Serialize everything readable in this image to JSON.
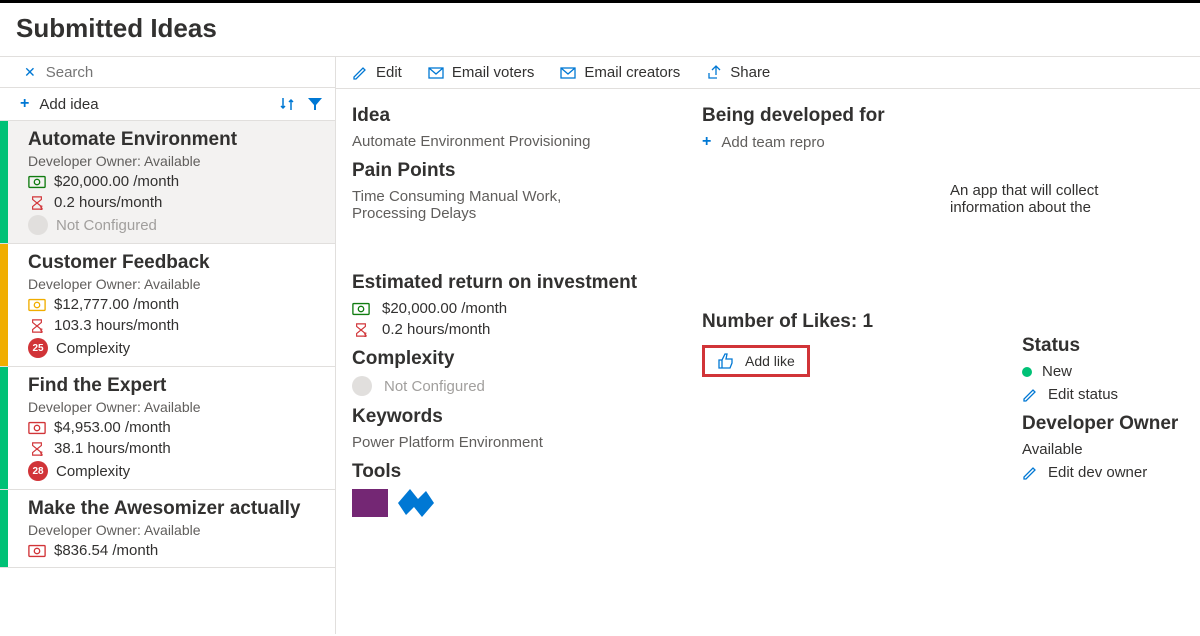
{
  "page_title": "Submitted Ideas",
  "search": {
    "placeholder": "Search"
  },
  "add_idea_label": "Add idea",
  "toolbar": {
    "edit": "Edit",
    "email_voters": "Email voters",
    "email_creators": "Email creators",
    "share": "Share"
  },
  "ideas": [
    {
      "title": "Automate Environment",
      "owner": "Developer Owner: Available",
      "money": "$20,000.00 /month",
      "hours": "0.2 hours/month",
      "complexity": "Not Configured",
      "bar": "green",
      "money_color": "green",
      "hour_color": "red",
      "badge": ""
    },
    {
      "title": "Customer Feedback",
      "owner": "Developer Owner: Available",
      "money": "$12,777.00 /month",
      "hours": "103.3 hours/month",
      "complexity": "Complexity",
      "bar": "yellow",
      "money_color": "yellow",
      "hour_color": "red",
      "badge": "25"
    },
    {
      "title": "Find the Expert",
      "owner": "Developer Owner: Available",
      "money": "$4,953.00 /month",
      "hours": "38.1 hours/month",
      "complexity": "Complexity",
      "bar": "green",
      "money_color": "red",
      "hour_color": "red",
      "badge": "28"
    },
    {
      "title": "Make the Awesomizer actually",
      "owner": "Developer Owner: Available",
      "money": "$836.54 /month",
      "hours": "",
      "complexity": "",
      "bar": "green",
      "money_color": "red",
      "hour_color": "",
      "badge": ""
    }
  ],
  "detail": {
    "idea_heading": "Idea",
    "idea_value": "Automate Environment Provisioning",
    "pain_heading": "Pain Points",
    "pain_value": "Time Consuming Manual Work, Processing Delays",
    "roi_heading": "Estimated return on investment",
    "roi_money": "$20,000.00 /month",
    "roi_hours": "0.2 hours/month",
    "complexity_heading": "Complexity",
    "complexity_value": "Not Configured",
    "keywords_heading": "Keywords",
    "keywords_value": "Power Platform Environment",
    "tools_heading": "Tools",
    "developed_heading": "Being developed for",
    "add_team": "Add team repro",
    "likes_heading": "Number of Likes: 1",
    "add_like": "Add like",
    "status_heading": "Status",
    "status_value": "New",
    "edit_status": "Edit status",
    "dev_owner_heading": "Developer Owner",
    "dev_owner_value": "Available",
    "edit_dev_owner": "Edit dev owner",
    "description": "An app that will collect information about the"
  }
}
